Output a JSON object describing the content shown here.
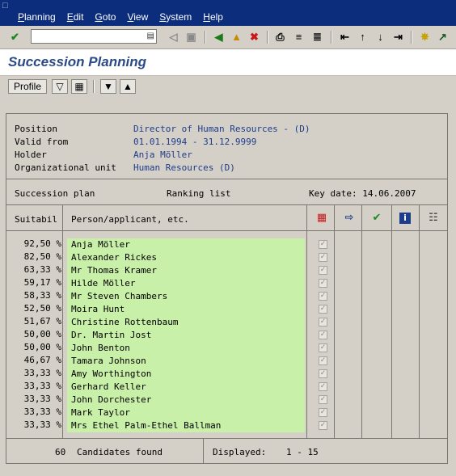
{
  "menubar": {
    "items": [
      "Planning",
      "Edit",
      "Goto",
      "View",
      "System",
      "Help"
    ]
  },
  "toolbar": {
    "command_field_value": ""
  },
  "page_title": "Succession Planning",
  "app_toolbar": {
    "profile_label": "Profile"
  },
  "header": {
    "position_label": "Position",
    "position_value": "Director of Human Resources - (D)",
    "valid_from_label": "Valid from",
    "valid_from_value": "01.01.1994 - 31.12.9999",
    "holder_label": "Holder",
    "holder_value": "Anja Möller",
    "org_unit_label": "Organizational unit",
    "org_unit_value": "Human Resources (D)"
  },
  "plan_bar": {
    "succession_plan": "Succession plan",
    "ranking_list": "Ranking list",
    "key_date": "Key date: 14.06.2007"
  },
  "columns": {
    "suitability": "Suitabil",
    "person": "Person/applicant, etc."
  },
  "candidates": [
    {
      "score": "92,50 %",
      "name": "Anja Möller"
    },
    {
      "score": "82,50 %",
      "name": "Alexander Rickes"
    },
    {
      "score": "63,33 %",
      "name": "Mr Thomas Kramer"
    },
    {
      "score": "59,17 %",
      "name": "Hilde Möller"
    },
    {
      "score": "58,33 %",
      "name": "Mr Steven Chambers"
    },
    {
      "score": "52,50 %",
      "name": "Moira Hunt"
    },
    {
      "score": "51,67 %",
      "name": "Christine Rottenbaum"
    },
    {
      "score": "50,00 %",
      "name": "Dr. Martin Jost"
    },
    {
      "score": "50,00 %",
      "name": "John Benton"
    },
    {
      "score": "46,67 %",
      "name": "Tamara Johnson"
    },
    {
      "score": "33,33 %",
      "name": "Amy Worthington"
    },
    {
      "score": "33,33 %",
      "name": "Gerhard Keller"
    },
    {
      "score": "33,33 %",
      "name": "John Dorchester"
    },
    {
      "score": "33,33 %",
      "name": "Mark Taylor"
    },
    {
      "score": "33,33 %",
      "name": "Mrs Ethel Palm-Ethel Ballman"
    }
  ],
  "footer": {
    "count": "60",
    "found_label": "Candidates found",
    "displayed_label": "Displayed:",
    "displayed_range": "1 - 15"
  },
  "colors": {
    "menubar_bg": "#0c2c7c",
    "title_color": "#2c4a86",
    "value_color": "#1c3c8c",
    "highlight_green": "#c8f0a8"
  },
  "icons": [
    "enter-icon",
    "save-icon",
    "back-icon",
    "exit-icon",
    "cancel-icon",
    "print-icon",
    "find-icon",
    "find-next-icon",
    "first-page-icon",
    "prev-page-icon",
    "next-page-icon",
    "last-page-icon",
    "new-session-icon",
    "shortcut-icon",
    "filter-icon",
    "layout-icon",
    "arrow-down-icon",
    "arrow-up-icon",
    "matrix-icon",
    "assign-icon",
    "check-icon",
    "info-icon",
    "hierarchy-icon"
  ]
}
